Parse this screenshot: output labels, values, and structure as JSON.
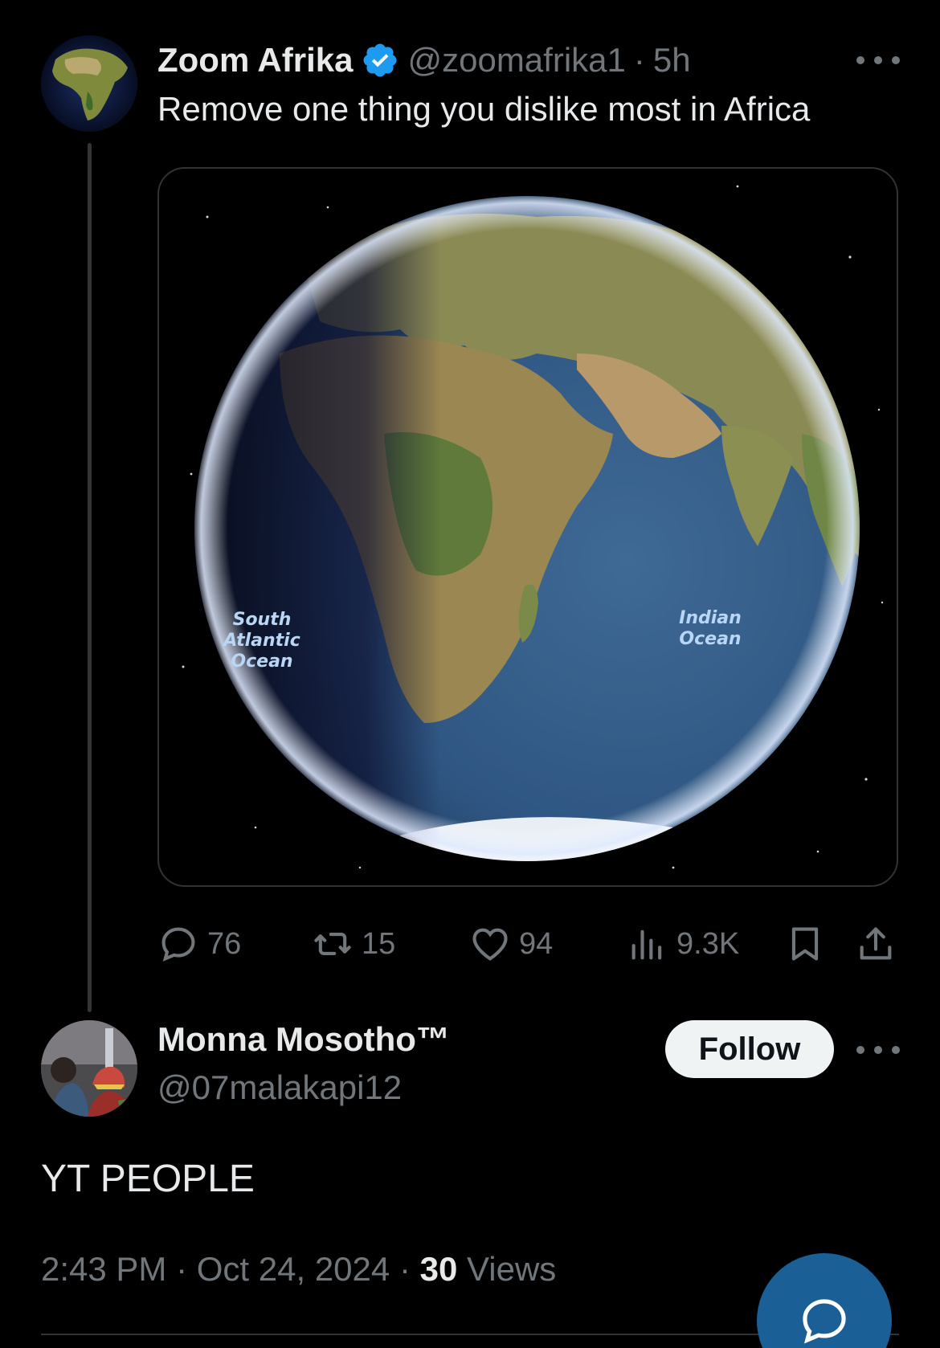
{
  "tweet": {
    "author_name": "Zoom Afrika",
    "handle": "@zoomafrika1",
    "separator": "·",
    "time_ago": "5h",
    "text": "Remove one thing you dislike most in Africa",
    "media": {
      "labels": {
        "south_atlantic": [
          "South",
          "Atlantic",
          "Ocean"
        ],
        "indian": [
          "Indian",
          "Ocean"
        ]
      }
    },
    "stats": {
      "replies": "76",
      "reposts": "15",
      "likes": "94",
      "views": "9.3K"
    }
  },
  "reply": {
    "author_name": "Monna Mosotho™",
    "handle": "@07malakapi12",
    "follow_label": "Follow",
    "text": "YT PEOPLE",
    "time": "2:43 PM",
    "date": "Oct 24, 2024",
    "views_count": "30",
    "views_label": "Views",
    "separator": "·"
  },
  "colors": {
    "background": "#000000",
    "text_primary": "#e7e9ea",
    "text_secondary": "#71767b",
    "verified_badge": "#1d9bf0",
    "fab": "#1a5f96"
  },
  "icons": [
    "verified-badge-icon",
    "more-icon",
    "reply-icon",
    "repost-icon",
    "like-icon",
    "views-icon",
    "bookmark-icon",
    "share-icon",
    "compose-reply-icon"
  ]
}
